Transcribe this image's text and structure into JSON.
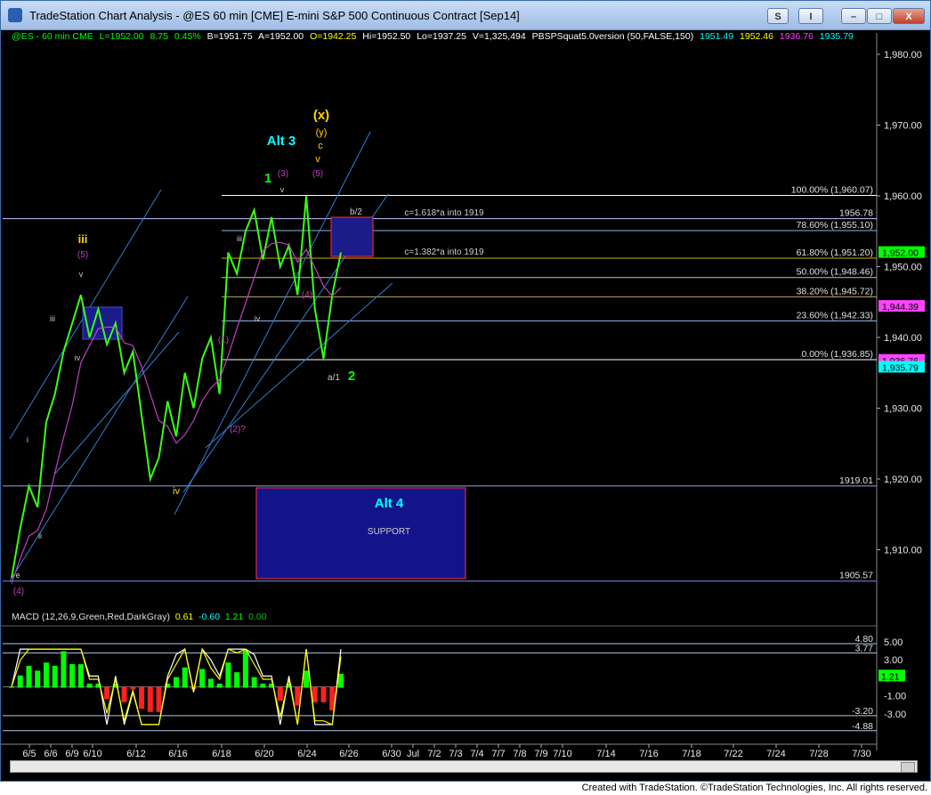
{
  "window": {
    "title": "TradeStation Chart Analysis - @ES 60 min [CME] E-mini S&P 500 Continuous Contract [Sep14]",
    "buttons": [
      "S",
      "I",
      "",
      "",
      "X"
    ]
  },
  "status": {
    "symbol": "@ES - 60 min  CME",
    "last": "L=1952.00",
    "change": "8.75",
    "pct": "0.45%",
    "bid": "B=1951.75",
    "ask": "A=1952.00",
    "open": "O=1942.25",
    "high": "Hi=1952.50",
    "low": "Lo=1937.25",
    "volume": "V=1,325,494",
    "indicator": "PBSPSquat5.0version (50,FALSE,150)",
    "ind_values": [
      "1951.49",
      "1952.46",
      "1936.76",
      "1935.79"
    ]
  },
  "macd": {
    "label": "MACD (12,26,9,Green,Red,DarkGray)",
    "values": [
      "0.61",
      "-0.60",
      "1.21",
      "0.00"
    ]
  },
  "chart_data": {
    "type": "line",
    "title": "",
    "xlabel": "",
    "ylabel": "",
    "ylim": [
      1900,
      1985
    ],
    "y_ticks": [
      "1,980.00",
      "1,970.00",
      "1,960.00",
      "1,950.00",
      "1,940.00",
      "1,930.00",
      "1,920.00",
      "1,910.00"
    ],
    "x_ticks": [
      "6/5",
      "6/6",
      "6/9",
      "6/10",
      "6/12",
      "6/16",
      "6/18",
      "6/20",
      "6/24",
      "6/26",
      "6/30",
      "Jul",
      "7/2",
      "7/3",
      "7/4",
      "7/7",
      "7/8",
      "7/9",
      "7/10",
      "7/14",
      "7/16",
      "7/18",
      "7/22",
      "7/24",
      "7/28",
      "7/30"
    ],
    "series": [
      {
        "values": [
          1906,
          1913,
          1919,
          1916,
          1928,
          1932,
          1938,
          1942,
          1946,
          1940,
          1944,
          1939,
          1942,
          1935,
          1938,
          1929,
          1920,
          1923,
          1931,
          1926,
          1935,
          1930,
          1937,
          1940,
          1932,
          1952,
          1949,
          1955,
          1958,
          1951,
          1957,
          1950,
          1953,
          1946,
          1960,
          1944,
          1937,
          1946,
          1952
        ]
      }
    ],
    "horizontal_levels": [
      {
        "label": "100.00% (1,960.07)",
        "value": 1960.07
      },
      {
        "label": "1956.78",
        "value": 1956.78
      },
      {
        "label": "78.60% (1,955.10)",
        "value": 1955.1
      },
      {
        "label": "61.80% (1,951.20)",
        "value": 1951.2
      },
      {
        "label": "50.00% (1,948.46)",
        "value": 1948.46
      },
      {
        "label": "38.20% (1,945.72)",
        "value": 1945.72
      },
      {
        "label": "23.60% (1,942.33)",
        "value": 1942.33
      },
      {
        "label": "0.00% (1,936.85)",
        "value": 1936.85
      },
      {
        "label": "1919.01",
        "value": 1919.01
      },
      {
        "label": "1905.57",
        "value": 1905.57
      }
    ],
    "price_tags": [
      {
        "label": "1,952.00",
        "value": 1952.0,
        "color": "#00ff00"
      },
      {
        "label": "1,944.39",
        "value": 1944.39,
        "color": "#ff44ff"
      },
      {
        "label": "1,936.76",
        "value": 1936.76,
        "color": "#ff44ff"
      },
      {
        "label": "1,935.79",
        "value": 1935.79,
        "color": "#00ffff"
      }
    ],
    "annotations": [
      "(x)",
      "(y)",
      "c",
      "v",
      "Alt 3",
      "1",
      "(3)",
      "v",
      "(5)",
      "iii",
      "(5)",
      "v",
      "iii",
      "iv",
      "iii",
      "iv",
      "(1)",
      "(2)?",
      "(4)",
      "b/2",
      "a/1",
      "2",
      "iv",
      "i",
      "ii",
      "e",
      "(4)",
      "c=1.618*a into 1919",
      "c=1.382*a into 1919",
      "Alt 4",
      "SUPPORT"
    ],
    "macd_ticks": [
      "5.00",
      "3.00",
      "1.00",
      "-1.00",
      "-3.00"
    ],
    "macd_levels": [
      "4.80",
      "3.77",
      "-3.20",
      "-4.88"
    ],
    "macd_tag": "1.21"
  },
  "footer": "Created with TradeStation. ©TradeStation Technologies, Inc. All rights reserved."
}
